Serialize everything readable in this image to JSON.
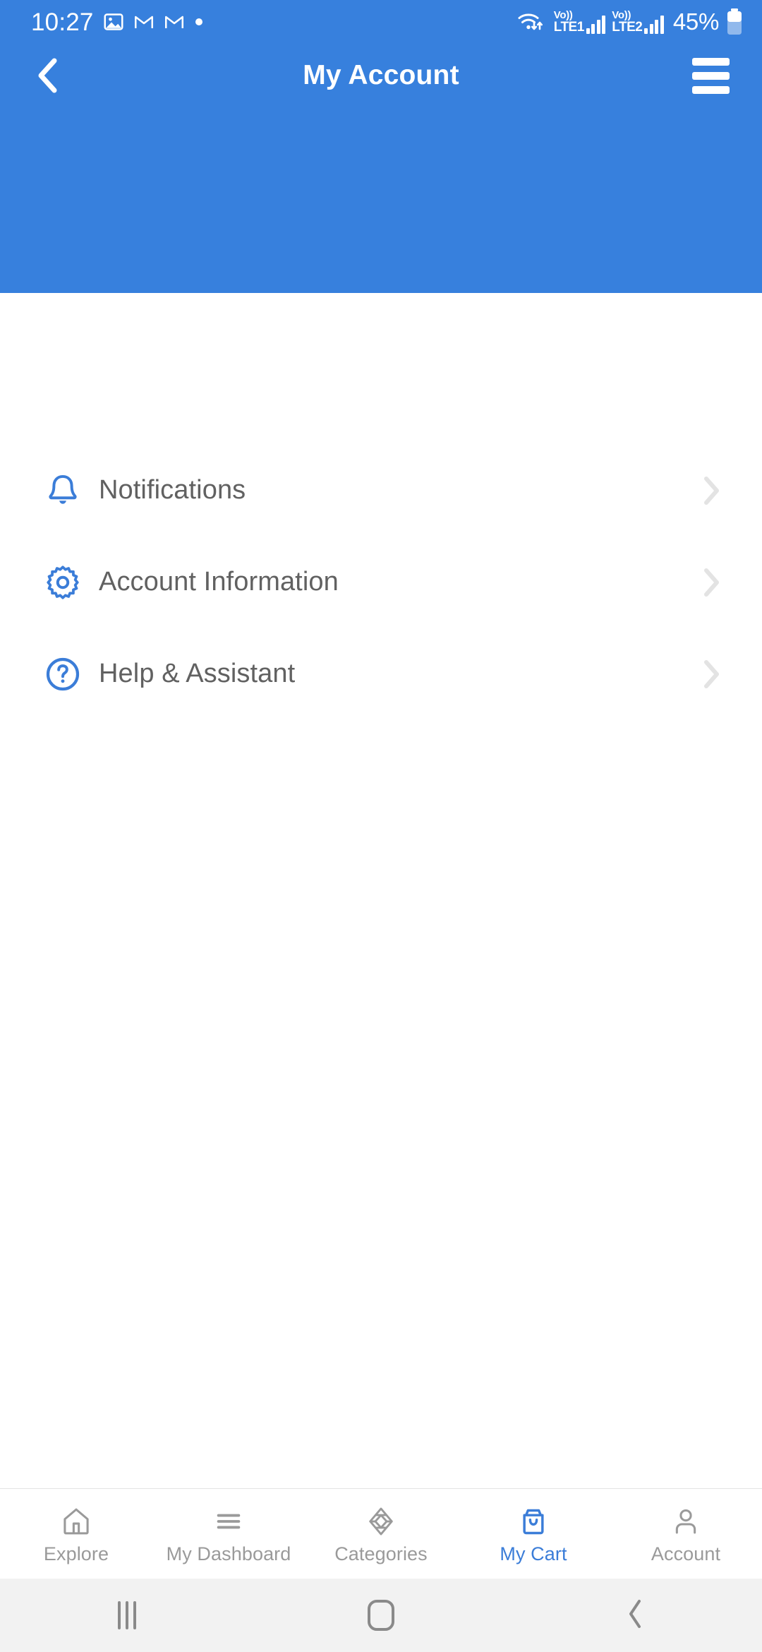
{
  "status_bar": {
    "time": "10:27",
    "left_icons": [
      "photo-icon",
      "gmail-icon",
      "gmail-icon",
      "dot-icon"
    ],
    "wifi_icon": "wifi-data-icon",
    "sim1": {
      "volte_top": "Vo))",
      "volte_bottom": "LTE1",
      "signal_bars": 4
    },
    "sim2": {
      "volte_top": "Vo))",
      "volte_bottom": "LTE2",
      "signal_bars": 4
    },
    "battery_percent": "45%",
    "battery_icon": "battery-icon"
  },
  "app_bar": {
    "back_icon": "chevron-left-icon",
    "title": "My Account",
    "menu_icon": "hamburger-menu-icon"
  },
  "menu": {
    "items": [
      {
        "label": "Notifications",
        "icon": "bell-icon",
        "chevron": "chevron-right-icon"
      },
      {
        "label": "Account Information",
        "icon": "gear-icon",
        "chevron": "chevron-right-icon"
      },
      {
        "label": "Help & Assistant",
        "icon": "question-circle-icon",
        "chevron": "chevron-right-icon"
      }
    ]
  },
  "tab_bar": {
    "active_index": 3,
    "items": [
      {
        "label": "Explore",
        "icon": "home-icon"
      },
      {
        "label": "My Dashboard",
        "icon": "list-lines-icon"
      },
      {
        "label": "Categories",
        "icon": "cube-diamond-icon"
      },
      {
        "label": "My Cart",
        "icon": "shopping-bag-icon"
      },
      {
        "label": "Account",
        "icon": "person-icon"
      }
    ]
  },
  "system_nav": {
    "recents_icon": "recents-icon",
    "home_icon": "home-square-icon",
    "back_icon": "back-chevron-icon"
  },
  "colors": {
    "header_blue": "#3780DD",
    "accent_blue": "#3B7DD8",
    "label_gray": "#616161",
    "tab_gray": "#9A9A9A",
    "chevron_gray": "#E3E3E3"
  }
}
